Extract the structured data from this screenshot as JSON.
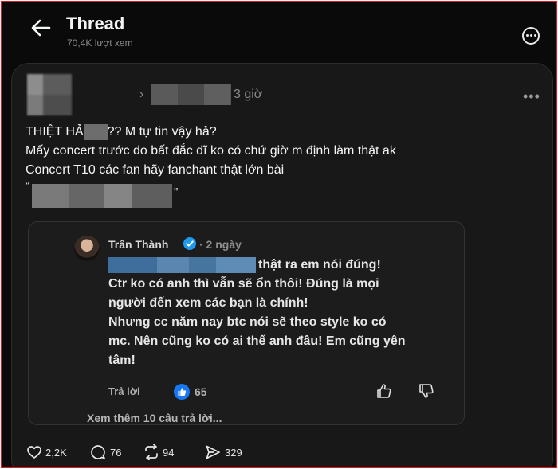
{
  "header": {
    "title": "Thread",
    "views": "70,4K lượt xem"
  },
  "post": {
    "time": "3 giờ",
    "lines": [
      "THIỆT HẢ",
      "?? M tự tin vậy hả?",
      "Mấy concert trước do bất đắc dĩ ko có chứ giờ m định làm thật ak",
      "Concert T10 các fan hãy fanchant thật lớn bài"
    ],
    "quote_open": "“",
    "quote_close": "”"
  },
  "reply": {
    "author": "Trấn Thành",
    "time": "· 2 ngày",
    "text_lines": [
      "thật ra em nói đúng!",
      "Ctr ko có anh thì vẫn sẽ ổn thôi! Đúng là mọi",
      "người đến xem các bạn là chính!",
      "Nhưng cc năm nay btc nói sẽ theo style ko có",
      "mc. Nên cũng ko có ai thế anh đâu! Em cũng yên",
      "tâm!"
    ],
    "reply_label": "Trả lời",
    "likes": "65",
    "see_more": "Xem thêm 10 câu trả lời..."
  },
  "actions": {
    "likes": "2,2K",
    "comments": "76",
    "reposts": "94",
    "shares": "329"
  },
  "colors": {
    "background": "#0a0a0a",
    "card": "#181818",
    "frame_border": "#e0181f",
    "like_blue": "#1877f2",
    "verified_blue": "#1d9bf0"
  },
  "icons": [
    "back-arrow-icon",
    "more-circle-icon",
    "chevron-right-icon",
    "ellipsis-icon",
    "verified-badge-icon",
    "like-badge-icon",
    "thumbs-up-icon",
    "thumbs-down-icon",
    "heart-icon",
    "comment-icon",
    "repost-icon",
    "share-icon"
  ]
}
